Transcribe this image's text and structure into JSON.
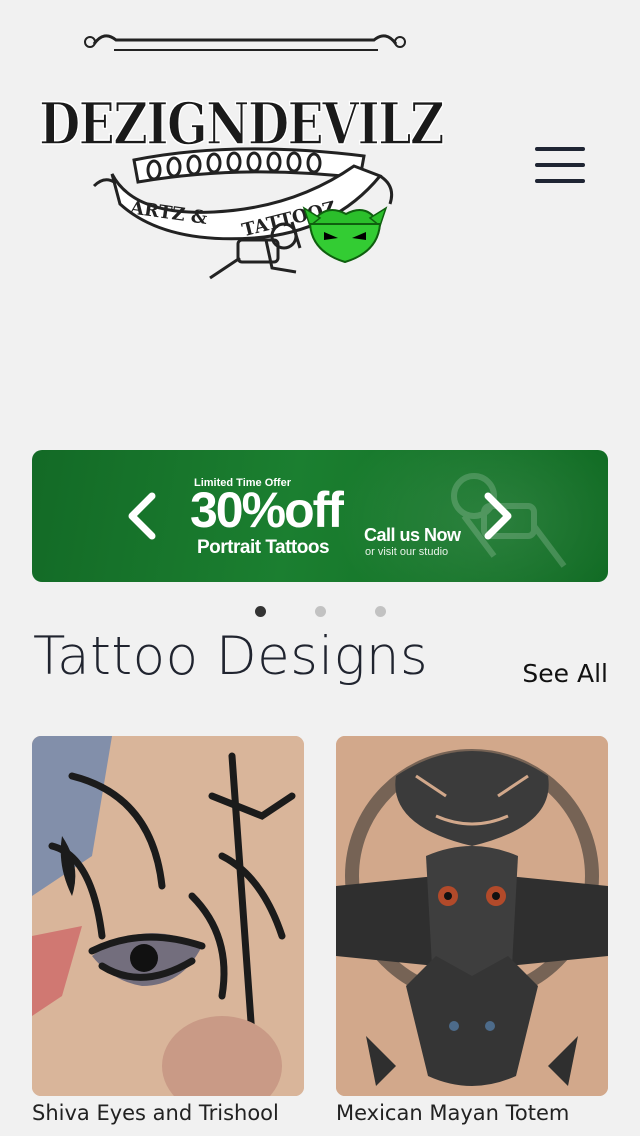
{
  "header": {
    "logo": {
      "brand": "DEZIGNDEVILZ",
      "tagline_left": "ARTZ &",
      "tagline_right": "TATTOOZ"
    },
    "menu_icon": "hamburger-icon"
  },
  "banner": {
    "slides_total": 3,
    "active_slide": 1,
    "prev_icon": "chevron-left-icon",
    "next_icon": "chevron-right-icon",
    "offer_label": "Limited Time Offer",
    "offer_amount": "30%off",
    "offer_subject": "Portrait Tattoos",
    "call_to_action": "Call us Now",
    "call_to_action_sub": "or visit our studio",
    "background_color": "#1b7f30"
  },
  "designs": {
    "title": "Tattoo Designs",
    "see_all_label": "See All",
    "items": [
      {
        "title": "Shiva Eyes and Trishool"
      },
      {
        "title": "Mexican Mayan Totem"
      }
    ]
  }
}
